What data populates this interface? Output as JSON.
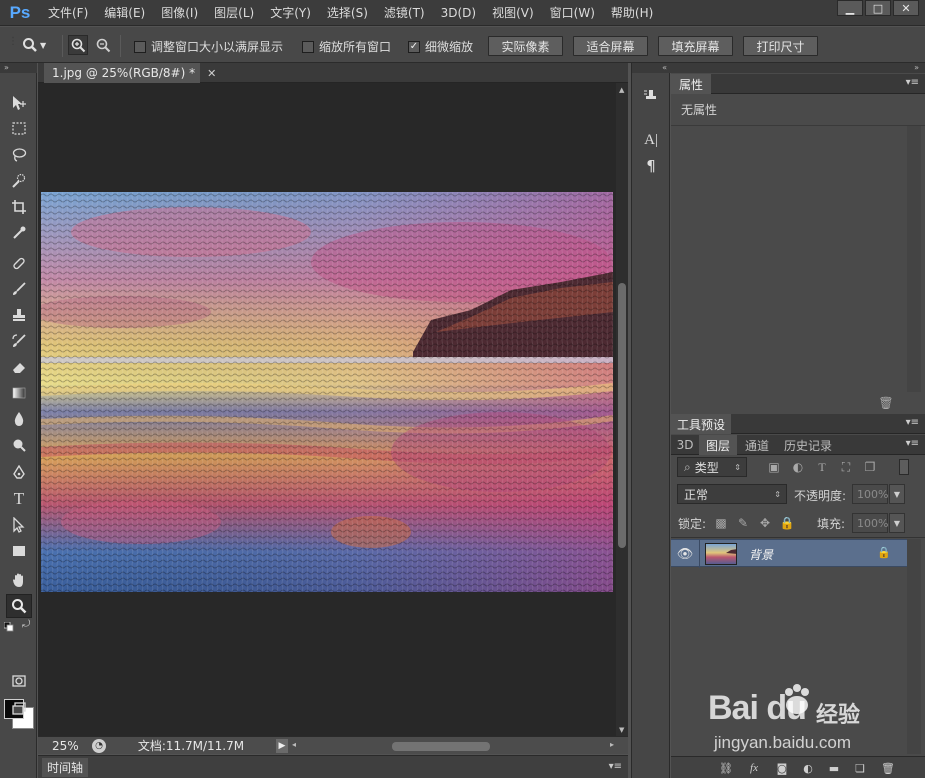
{
  "app": {
    "logo": "Ps",
    "menus": [
      "文件(F)",
      "编辑(E)",
      "图像(I)",
      "图层(L)",
      "文字(Y)",
      "选择(S)",
      "滤镜(T)",
      "3D(D)",
      "视图(V)",
      "窗口(W)",
      "帮助(H)"
    ],
    "window_buttons": [
      "▁",
      "□",
      "✕"
    ]
  },
  "options": {
    "resize_windows": "调整窗口大小以满屏显示",
    "zoom_all": "缩放所有窗口",
    "scrubby_zoom": "细微缩放",
    "actual_pixels": "实际像素",
    "fit_screen": "适合屏幕",
    "fill_screen": "填充屏幕",
    "print_size": "打印尺寸",
    "checked": {
      "resize_windows": false,
      "zoom_all": false,
      "scrubby_zoom": true
    }
  },
  "document": {
    "tab_title": "1.jpg @ 25%(RGB/8#) *",
    "zoom": "25%",
    "doc_info": "文档:11.7M/11.7M",
    "timeline_label": "时间轴"
  },
  "properties": {
    "tab": "属性",
    "empty_text": "无属性"
  },
  "tool_presets": {
    "tab": "工具预设"
  },
  "layers_panel": {
    "tabs": [
      "3D",
      "图层",
      "通道",
      "历史记录"
    ],
    "active_tab": "图层",
    "filter_kind": "类型",
    "blend_mode": "正常",
    "opacity_label": "不透明度:",
    "opacity_value": "100%",
    "lock_label": "锁定:",
    "fill_label": "填充:",
    "fill_value": "100%",
    "layers": [
      {
        "name": "背景",
        "visible": true,
        "locked": true
      }
    ]
  },
  "watermark": {
    "brand": "Bai du",
    "cn": "经验",
    "url": "jingyan.baidu.com"
  },
  "colors": {
    "accent": "#58a9ff",
    "layer_selected": "#5b6f8d"
  }
}
